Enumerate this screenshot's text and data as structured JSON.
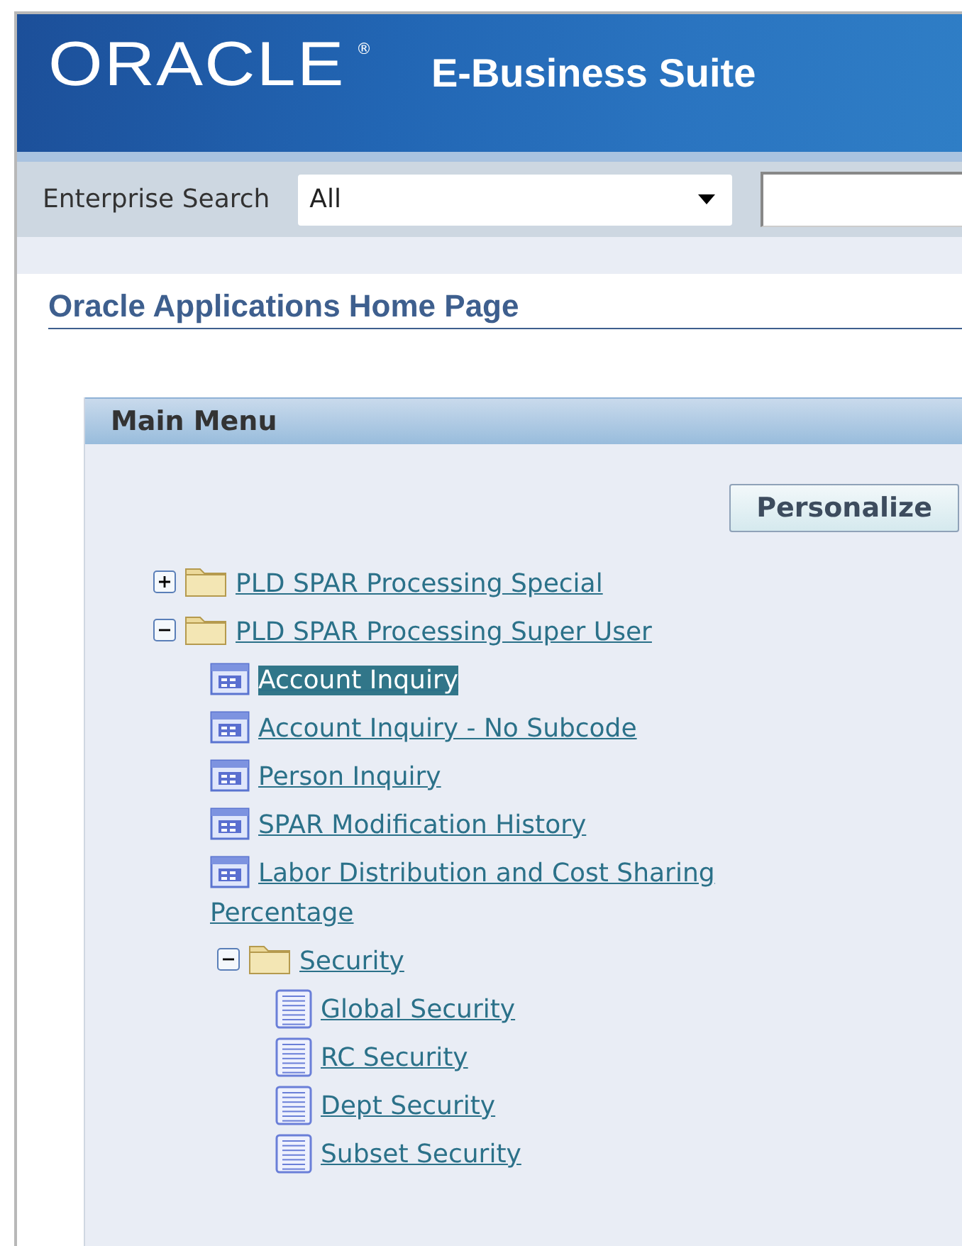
{
  "header": {
    "logo": "ORACLE",
    "registered_mark": "®",
    "product": "E-Business Suite"
  },
  "search": {
    "label": "Enterprise Search",
    "scope": "All"
  },
  "page_title": "Oracle Applications Home Page",
  "main_menu": {
    "title": "Main Menu",
    "button": "Personalize",
    "tree": [
      {
        "kind": "folder",
        "label": "PLD SPAR Processing Special",
        "expanded": false
      },
      {
        "kind": "folder",
        "label": "PLD SPAR Processing Super User",
        "expanded": true,
        "children": [
          {
            "kind": "function",
            "label": "Account Inquiry",
            "selected": true
          },
          {
            "kind": "function",
            "label": "Account Inquiry - No Subcode",
            "selected": false
          },
          {
            "kind": "function",
            "label": "Person Inquiry",
            "selected": false
          },
          {
            "kind": "function",
            "label": "SPAR Modification History",
            "selected": false
          },
          {
            "kind": "function",
            "label": "Labor Distribution and Cost Sharing Percentage",
            "selected": false
          },
          {
            "kind": "folder",
            "label": "Security",
            "expanded": true,
            "children": [
              {
                "kind": "document",
                "label": "Global Security",
                "selected": false
              },
              {
                "kind": "document",
                "label": "RC Security",
                "selected": false
              },
              {
                "kind": "document",
                "label": "Dept Security",
                "selected": false
              },
              {
                "kind": "document",
                "label": "Subset Security",
                "selected": false
              }
            ]
          }
        ]
      }
    ]
  }
}
